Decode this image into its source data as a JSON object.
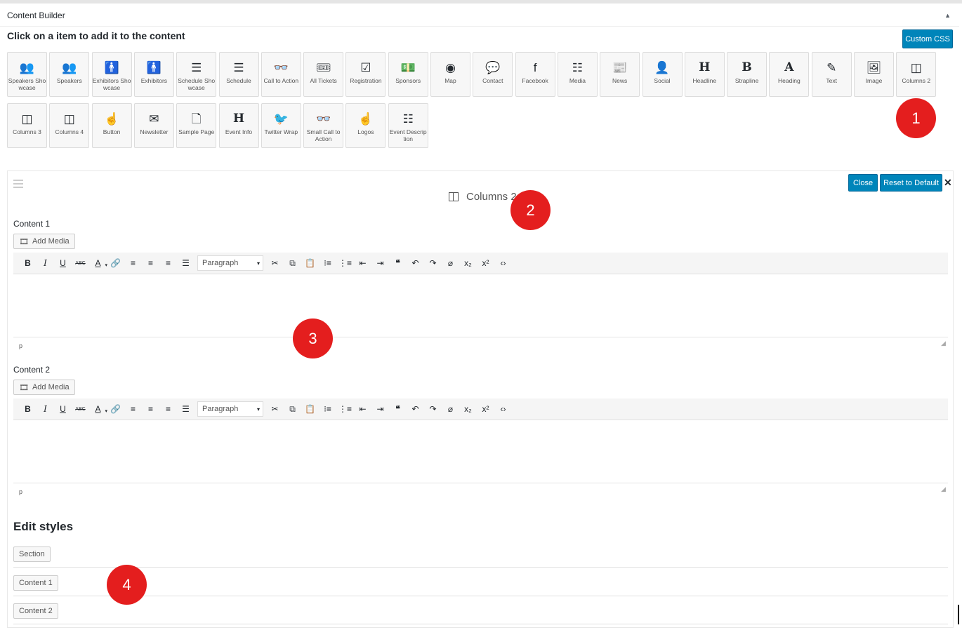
{
  "panel": {
    "title": "Content Builder",
    "toggle": "▲"
  },
  "instruction": "Click on a item to add it to the content",
  "custom_css": "Custom CSS",
  "blocks_row1": [
    {
      "label": "Speakers Showcase",
      "icon": "users-icon",
      "glyph": "👥"
    },
    {
      "label": "Speakers",
      "icon": "users-icon",
      "glyph": "👥"
    },
    {
      "label": "Exhibitors Showcase",
      "icon": "person-icon",
      "glyph": "🚹"
    },
    {
      "label": "Exhibitors",
      "icon": "person-icon",
      "glyph": "🚹"
    },
    {
      "label": "Schedule Showcase",
      "icon": "server-icon",
      "glyph": "☰"
    },
    {
      "label": "Schedule",
      "icon": "server-icon",
      "glyph": "☰"
    },
    {
      "label": "Call to Action",
      "icon": "glasses-icon",
      "glyph": "👓"
    },
    {
      "label": "All Tickets",
      "icon": "ticket-icon",
      "glyph": "🎟"
    },
    {
      "label": "Registration",
      "icon": "checkbox-icon",
      "glyph": "☑"
    },
    {
      "label": "Sponsors",
      "icon": "money-icon",
      "glyph": "💵"
    },
    {
      "label": "Map",
      "icon": "target-icon",
      "glyph": "◉"
    },
    {
      "label": "Contact",
      "icon": "speech-bubble-icon",
      "glyph": "💬"
    },
    {
      "label": "Facebook",
      "icon": "facebook-icon",
      "glyph": "f"
    },
    {
      "label": "Media",
      "icon": "list-icon",
      "glyph": "☷"
    },
    {
      "label": "News",
      "icon": "newspaper-icon",
      "glyph": "📰"
    },
    {
      "label": "Social",
      "icon": "add-user-icon",
      "glyph": "👤"
    },
    {
      "label": "Headline",
      "icon": "heading-h-icon",
      "glyph": "H"
    },
    {
      "label": "Strapline",
      "icon": "bold-b-icon",
      "glyph": "B"
    },
    {
      "label": "Heading",
      "icon": "font-a-icon",
      "glyph": "A"
    },
    {
      "label": "Text",
      "icon": "pencil-icon",
      "glyph": "✎"
    },
    {
      "label": "Image",
      "icon": "image-icon",
      "glyph": "🖼"
    },
    {
      "label": "Columns 2",
      "icon": "columns-icon",
      "glyph": "◫"
    }
  ],
  "blocks_row2": [
    {
      "label": "Columns 3",
      "icon": "columns-icon",
      "glyph": "◫"
    },
    {
      "label": "Columns 4",
      "icon": "columns-icon",
      "glyph": "◫"
    },
    {
      "label": "Button",
      "icon": "hand-pointer-icon",
      "glyph": "☝"
    },
    {
      "label": "Newsletter",
      "icon": "envelope-icon",
      "glyph": "✉"
    },
    {
      "label": "Sample Page",
      "icon": "file-icon",
      "glyph": "🗋"
    },
    {
      "label": "Event Info",
      "icon": "heading-h-icon",
      "glyph": "H"
    },
    {
      "label": "Twitter Wrap",
      "icon": "twitter-icon",
      "glyph": "🐦"
    },
    {
      "label": "Small Call to Action",
      "icon": "glasses-icon",
      "glyph": "👓"
    },
    {
      "label": "Logos",
      "icon": "hand-pointer-icon",
      "glyph": "☝"
    },
    {
      "label": "Event Description",
      "icon": "list-icon",
      "glyph": "☷"
    }
  ],
  "editor": {
    "title": "Columns 2",
    "close": "Close",
    "reset": "Reset to Default",
    "content1_label": "Content 1",
    "content2_label": "Content 2",
    "add_media": "Add Media",
    "format_value": "Paragraph",
    "path": "p",
    "edit_styles": "Edit styles",
    "style_buttons": [
      "Section",
      "Content 1",
      "Content 2"
    ]
  },
  "toolbar_buttons": [
    {
      "name": "bold-button",
      "glyph": "B",
      "cls": "b"
    },
    {
      "name": "italic-button",
      "glyph": "I",
      "cls": "i"
    },
    {
      "name": "underline-button",
      "glyph": "U",
      "cls": "u"
    },
    {
      "name": "strikethrough-button",
      "glyph": "ABC",
      "cls": "s"
    },
    {
      "name": "text-color-button",
      "glyph": "A",
      "cls": "u caret-after"
    },
    {
      "name": "link-button",
      "glyph": "🔗",
      "cls": ""
    },
    {
      "name": "align-left-button",
      "glyph": "≡",
      "cls": ""
    },
    {
      "name": "align-center-button",
      "glyph": "≡",
      "cls": ""
    },
    {
      "name": "align-right-button",
      "glyph": "≡",
      "cls": ""
    },
    {
      "name": "justify-button",
      "glyph": "☰",
      "cls": ""
    }
  ],
  "toolbar_buttons_after": [
    {
      "name": "cut-button",
      "glyph": "✂",
      "cls": ""
    },
    {
      "name": "copy-button",
      "glyph": "⧉",
      "cls": ""
    },
    {
      "name": "paste-button",
      "glyph": "📋",
      "cls": ""
    },
    {
      "name": "bullet-list-button",
      "glyph": "⁝≡",
      "cls": ""
    },
    {
      "name": "numbered-list-button",
      "glyph": "⋮≡",
      "cls": ""
    },
    {
      "name": "outdent-button",
      "glyph": "⇤",
      "cls": ""
    },
    {
      "name": "indent-button",
      "glyph": "⇥",
      "cls": ""
    },
    {
      "name": "blockquote-button",
      "glyph": "❝",
      "cls": "b"
    },
    {
      "name": "undo-button",
      "glyph": "↶",
      "cls": ""
    },
    {
      "name": "redo-button",
      "glyph": "↷",
      "cls": ""
    },
    {
      "name": "clear-formatting-button",
      "glyph": "⌀",
      "cls": ""
    },
    {
      "name": "subscript-button",
      "glyph": "x₂",
      "cls": ""
    },
    {
      "name": "superscript-button",
      "glyph": "x²",
      "cls": ""
    },
    {
      "name": "source-code-button",
      "glyph": "‹›",
      "cls": ""
    }
  ],
  "badges": [
    "1",
    "2",
    "3",
    "4"
  ],
  "colors": {
    "primary": "#0085ba",
    "badge": "#e41e1e"
  }
}
